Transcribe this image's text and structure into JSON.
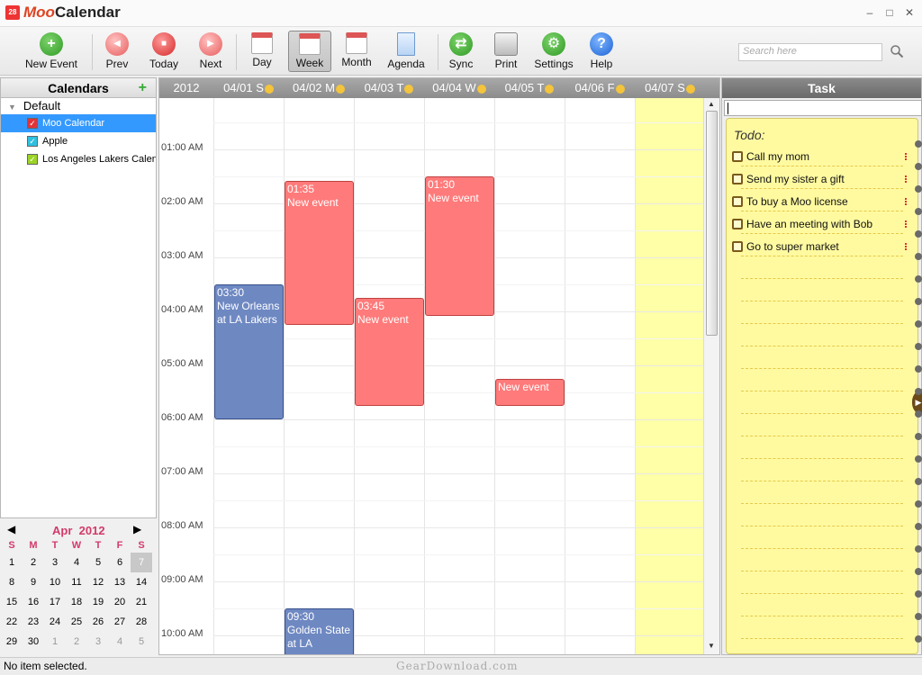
{
  "window": {
    "logo_text": "28",
    "title_part1": "Moo",
    "title_part2": "Calendar",
    "minimize": "–",
    "maximize": "□",
    "close": "✕"
  },
  "toolbar": {
    "new_event": "New Event",
    "prev": "Prev",
    "today": "Today",
    "next": "Next",
    "day": "Day",
    "week": "Week",
    "month": "Month",
    "agenda": "Agenda",
    "sync": "Sync",
    "print": "Print",
    "settings": "Settings",
    "help": "Help",
    "active_view": "Week",
    "search_placeholder": "Search here"
  },
  "calendars": {
    "header": "Calendars",
    "add": "+",
    "group": "Default",
    "items": [
      {
        "label": "Moo Calendar",
        "color": "#e0343a",
        "checked": true,
        "selected": true
      },
      {
        "label": "Apple",
        "color": "#2ec0e0",
        "checked": true,
        "selected": false
      },
      {
        "label": "Los Angeles Lakers Calendar",
        "color": "#9cd426",
        "checked": true,
        "selected": false
      }
    ]
  },
  "mini_calendar": {
    "prev": "◀",
    "next": "▶",
    "month": "Apr",
    "year": "2012",
    "dow": [
      "S",
      "M",
      "T",
      "W",
      "T",
      "F",
      "S"
    ],
    "weeks": [
      [
        "1",
        "2",
        "3",
        "4",
        "5",
        "6",
        "7"
      ],
      [
        "8",
        "9",
        "10",
        "11",
        "12",
        "13",
        "14"
      ],
      [
        "15",
        "16",
        "17",
        "18",
        "19",
        "20",
        "21"
      ],
      [
        "22",
        "23",
        "24",
        "25",
        "26",
        "27",
        "28"
      ],
      [
        "29",
        "30",
        "1",
        "2",
        "3",
        "4",
        "5"
      ]
    ],
    "today": "7"
  },
  "week_view": {
    "year": "2012",
    "days": [
      {
        "label": "04/01 S",
        "weekend": false
      },
      {
        "label": "04/02 M",
        "weekend": false
      },
      {
        "label": "04/03 T",
        "weekend": false
      },
      {
        "label": "04/04 W",
        "weekend": false
      },
      {
        "label": "04/05 T",
        "weekend": false
      },
      {
        "label": "04/06 F",
        "weekend": false
      },
      {
        "label": "04/07 S",
        "weekend": true
      }
    ],
    "times": [
      "01:00  AM",
      "02:00  AM",
      "03:00  AM",
      "04:00  AM",
      "05:00  AM",
      "06:00  AM",
      "07:00  AM",
      "08:00  AM",
      "09:00  AM",
      "10:00  AM"
    ],
    "events": [
      {
        "day": 0,
        "start": "03:30",
        "end": "06:00",
        "time": "03:30",
        "title": "New Orleans at LA Lakers",
        "color": "blue"
      },
      {
        "day": 1,
        "start": "01:35",
        "end": "04:15",
        "time": "01:35",
        "title": "New event",
        "color": "red"
      },
      {
        "day": 2,
        "start": "03:45",
        "end": "05:45",
        "time": "03:45",
        "title": "New event",
        "color": "red"
      },
      {
        "day": 3,
        "start": "01:30",
        "end": "04:05",
        "time": "01:30",
        "title": "New event",
        "color": "red"
      },
      {
        "day": 4,
        "start": "05:15",
        "end": "05:45",
        "time": "",
        "title": "New event",
        "color": "red"
      },
      {
        "day": 1,
        "start": "09:30",
        "end": "10:45",
        "time": "09:30",
        "title": "Golden State at LA",
        "color": "blue"
      }
    ]
  },
  "tasks": {
    "header": "Task",
    "todo_title": "Todo:",
    "items": [
      "Call my mom",
      "Send my sister a gift",
      "To buy a Moo license",
      "Have an meeting with Bob",
      "Go to super market"
    ]
  },
  "status": {
    "text": "No item selected.",
    "watermark": "GearDownload.com"
  }
}
